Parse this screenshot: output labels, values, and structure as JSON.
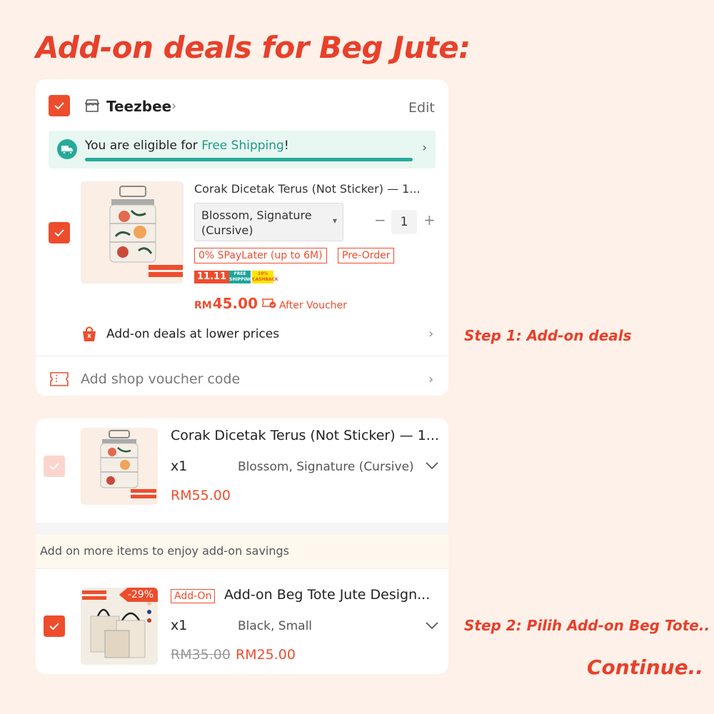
{
  "headline": "Add-on deals for Beg Jute:",
  "colors": {
    "accent": "#ee4d2d",
    "free_shipping_green": "#26aa99",
    "background": "#fdf1e9"
  },
  "cart_card": {
    "shop_name": "Teezbee",
    "edit_label": "Edit",
    "shipping_banner": {
      "prefix": "You are eligible for ",
      "highlight": "Free Shipping",
      "suffix": "!",
      "progress": 1.0
    },
    "item": {
      "title": "Corak Dicetak Terus (Not Sticker) — 1...",
      "variant": "Blossom, Signature (Cursive)",
      "quantity": "1",
      "tags": [
        "0% SPayLater (up to 6M)",
        "Pre-Order"
      ],
      "promo": {
        "label1": "11.11",
        "label2": "FREE SHIPPING",
        "label3": "10% CASHBACK"
      },
      "currency": "RM",
      "price": "45.00",
      "after_voucher": "After Voucher"
    },
    "addon_row_label": "Add-on deals at lower prices",
    "voucher_label": "Add shop voucher code"
  },
  "addon_card": {
    "main_item": {
      "title": "Corak Dicetak Terus (Not Sticker) — 1...",
      "quantity": "x1",
      "variant": "Blossom, Signature (Cursive)",
      "price": "RM55.00"
    },
    "addon_hint": "Add on more items to enjoy add-on savings",
    "addon_item": {
      "badge": "Add-On",
      "title": "Add-on Beg Tote Jute Design...",
      "quantity": "x1",
      "variant": "Black, Small",
      "original_price": "RM35.00",
      "price": "RM25.00",
      "discount": "-29%"
    }
  },
  "steps": {
    "step1": "Step 1: Add-on deals",
    "step2": "Step 2: Pilih Add-on Beg Tote..",
    "continue": "Continue.."
  }
}
